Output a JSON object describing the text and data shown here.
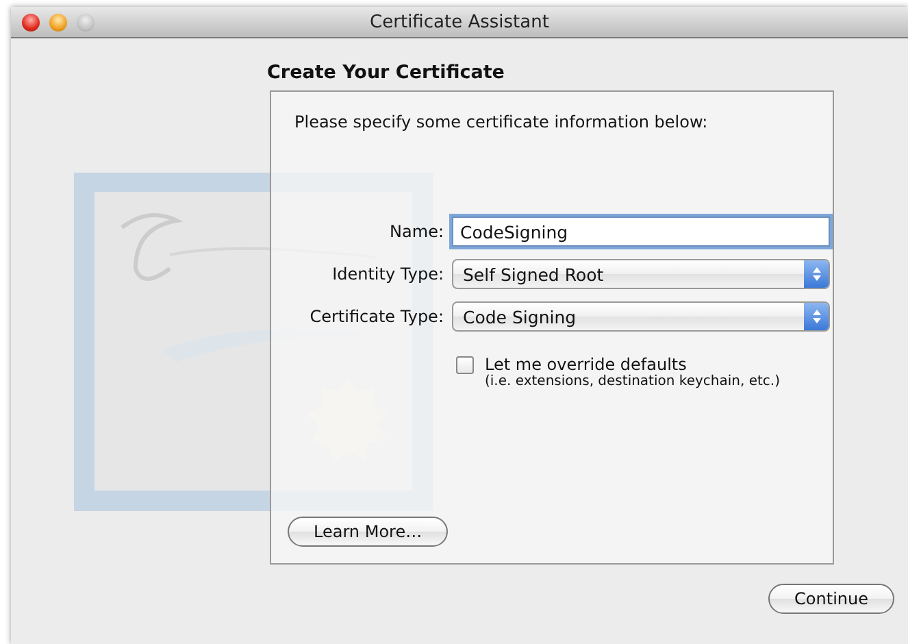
{
  "window": {
    "title": "Certificate Assistant"
  },
  "heading": "Create Your Certificate",
  "instructions": "Please specify some certificate information below:",
  "form": [
    {
      "kind": "text",
      "label": "Name:",
      "value": "CodeSigning",
      "focused": true
    },
    {
      "kind": "popup",
      "label": "Identity Type:",
      "value": "Self Signed Root"
    },
    {
      "kind": "popup",
      "label": "Certificate Type:",
      "value": "Code Signing"
    }
  ],
  "override": {
    "label": "Let me override defaults",
    "note": "(i.e. extensions, destination keychain, etc.)",
    "checked": false
  },
  "buttons": [
    {
      "label": "Learn More…",
      "kind": "secondary"
    },
    {
      "label": "Continue",
      "kind": "primary"
    }
  ]
}
